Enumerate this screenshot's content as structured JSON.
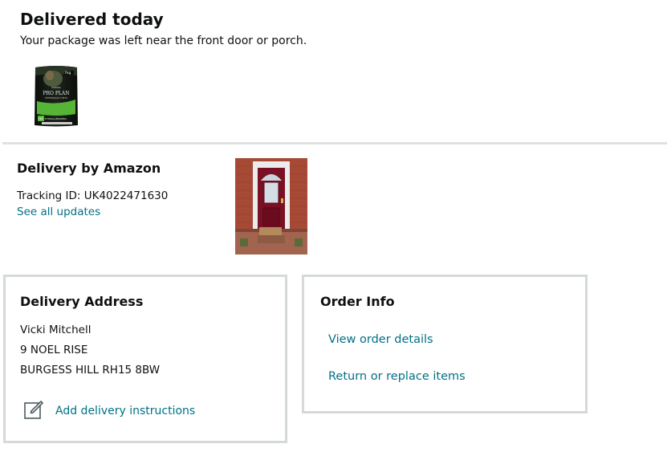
{
  "status": {
    "title": "Delivered today",
    "subtitle": "Your package was left near the front door or porch."
  },
  "product": {
    "brand_text": "PURINA",
    "product_line": "PRO PLAN",
    "product_sub": "VETERINARY DIETS",
    "variant_code": "HA",
    "variant_label": "HYPOALLERGENIC",
    "weight": "7kg"
  },
  "carrier": {
    "title": "Delivery by Amazon",
    "tracking": "Tracking ID: UK4022471630",
    "see_updates": "See all updates"
  },
  "address_card": {
    "title": "Delivery Address",
    "lines": [
      "Vicki Mitchell",
      "9 NOEL RISE",
      "BURGESS HILL RH15 8BW"
    ],
    "add_instructions": "Add delivery instructions",
    "icon": "edit-note-icon"
  },
  "order_card": {
    "title": "Order Info",
    "view_details": "View order details",
    "return_items": "Return or replace items"
  },
  "colors": {
    "link": "#007185",
    "text": "#0f1111",
    "border": "#d5d9d9"
  }
}
